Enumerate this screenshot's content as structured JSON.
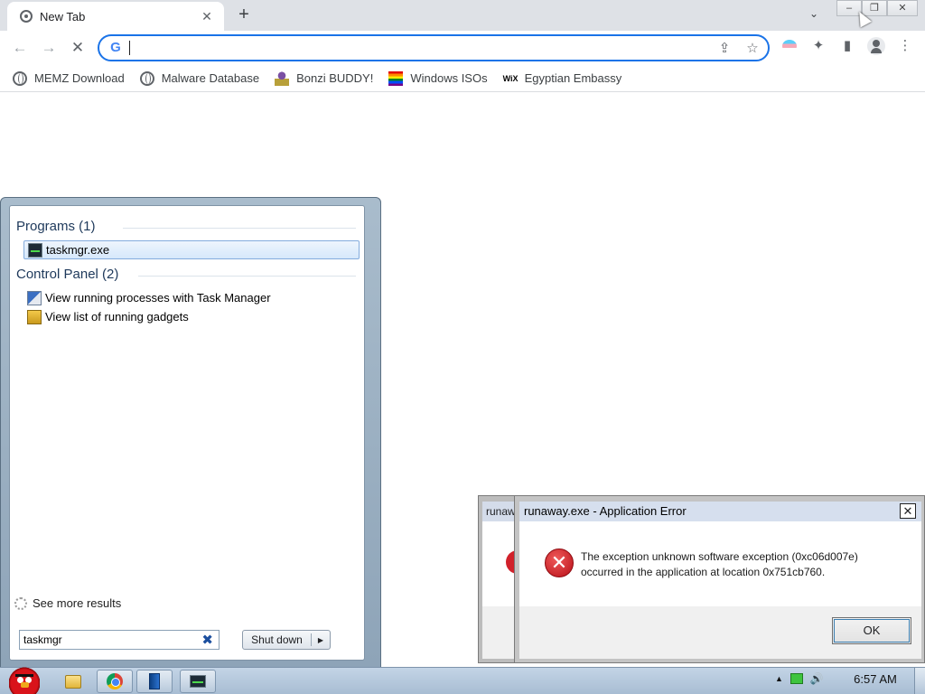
{
  "browser": {
    "tab": {
      "title": "New Tab",
      "close": "✕"
    },
    "new_tab": "+",
    "tab_search": "⌄",
    "window_controls": {
      "minimize": "–",
      "restore": "❐",
      "close": "✕"
    },
    "nav": {
      "back": "←",
      "forward": "→",
      "stop": "✕"
    },
    "omnibox": {
      "value": "",
      "provider_icon": "G",
      "share_icon": "⇪",
      "star_icon": "☆"
    },
    "toolbar_icons": {
      "extensions": "✦",
      "side_panel": "▮",
      "menu": "⋮"
    },
    "bookmarks": [
      {
        "label": "MEMZ Download",
        "icon": "globe-icon"
      },
      {
        "label": "Malware Database",
        "icon": "globe-icon"
      },
      {
        "label": "Bonzi BUDDY!",
        "icon": "bonzi-icon"
      },
      {
        "label": "Windows ISOs",
        "icon": "rainbow-flag-icon"
      },
      {
        "label": "Egyptian Embassy",
        "icon": "wix-icon",
        "icon_text": "WiX"
      }
    ]
  },
  "start_menu": {
    "programs_heading": "Programs (1)",
    "programs": [
      {
        "label": "taskmgr.exe",
        "icon": "task-manager-icon",
        "selected": true
      }
    ],
    "control_panel_heading": "Control Panel (2)",
    "control_panel": [
      {
        "label": "View running processes with Task Manager",
        "icon": "control-panel-icon"
      },
      {
        "label": "View list of running gadgets",
        "icon": "gadgets-icon"
      }
    ],
    "see_more": "See more results",
    "search_value": "taskmgr",
    "clear_search": "✖",
    "shutdown_label": "Shut down",
    "shutdown_arrow": "▶"
  },
  "error_dialog_back": {
    "title": "runaway.exe - Application Error"
  },
  "error_dialog": {
    "title": "runaway.exe - Application Error",
    "close": "✕",
    "icon": "✕",
    "message_line1": "The exception unknown software exception (0xc06d007e)",
    "message_line2": "occurred in the application at location 0x751cb760.",
    "ok_label": "OK"
  },
  "taskbar": {
    "buttons": [
      {
        "name": "windows-explorer",
        "icon": "folder-icon"
      },
      {
        "name": "google-chrome",
        "icon": "chrome-icon"
      },
      {
        "name": "book",
        "icon": "book-icon"
      },
      {
        "name": "task-manager",
        "icon": "task-manager-icon"
      }
    ],
    "tray": {
      "show_hidden": "▲",
      "speaker": "🔊"
    },
    "clock": "6:57 AM"
  }
}
